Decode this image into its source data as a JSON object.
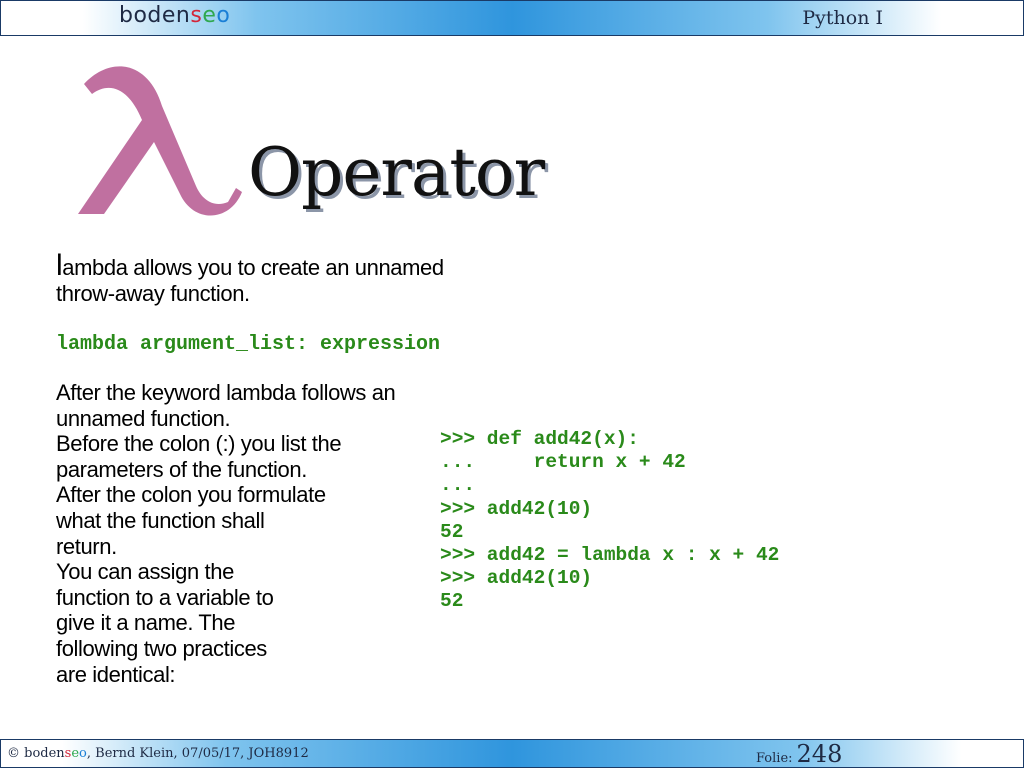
{
  "header": {
    "logo_main": "boden",
    "logo_s": "s",
    "logo_e": "e",
    "logo_o": "o",
    "title": "Python I"
  },
  "slide": {
    "heading": "Operator",
    "intro_dropcap": "l",
    "intro_rest": "ambda allows you to create an unnamed throw-away function.",
    "syntax": "lambda argument_list: expression",
    "explanation": [
      "After the keyword lambda follows an",
      "unnamed function.",
      "Before the colon (:) you list the",
      "parameters of the function.",
      "After the colon you formulate",
      "what the function shall",
      "return.",
      "You can assign the",
      "function to a variable to",
      "give it a name. The",
      "following two practices",
      "are identical:"
    ],
    "code": [
      ">>> def add42(x):",
      "...     return x + 42",
      "...",
      ">>> add42(10)",
      "52",
      ">>> add42 = lambda x : x + 42",
      ">>> add42(10)",
      "52"
    ]
  },
  "footer": {
    "copyright": "© boden",
    "seo_s": "s",
    "seo_e": "e",
    "seo_o": "o",
    "author_date": ", Bernd Klein, 07/05/17, JOH8912",
    "folie_label": "Folie:",
    "folie_number": "248"
  },
  "colors": {
    "lambda": "#c070a0",
    "code_green": "#2a8a1a",
    "bar_blue": "#2f95dd"
  },
  "icons": {
    "lambda": "lambda-symbol-icon"
  }
}
